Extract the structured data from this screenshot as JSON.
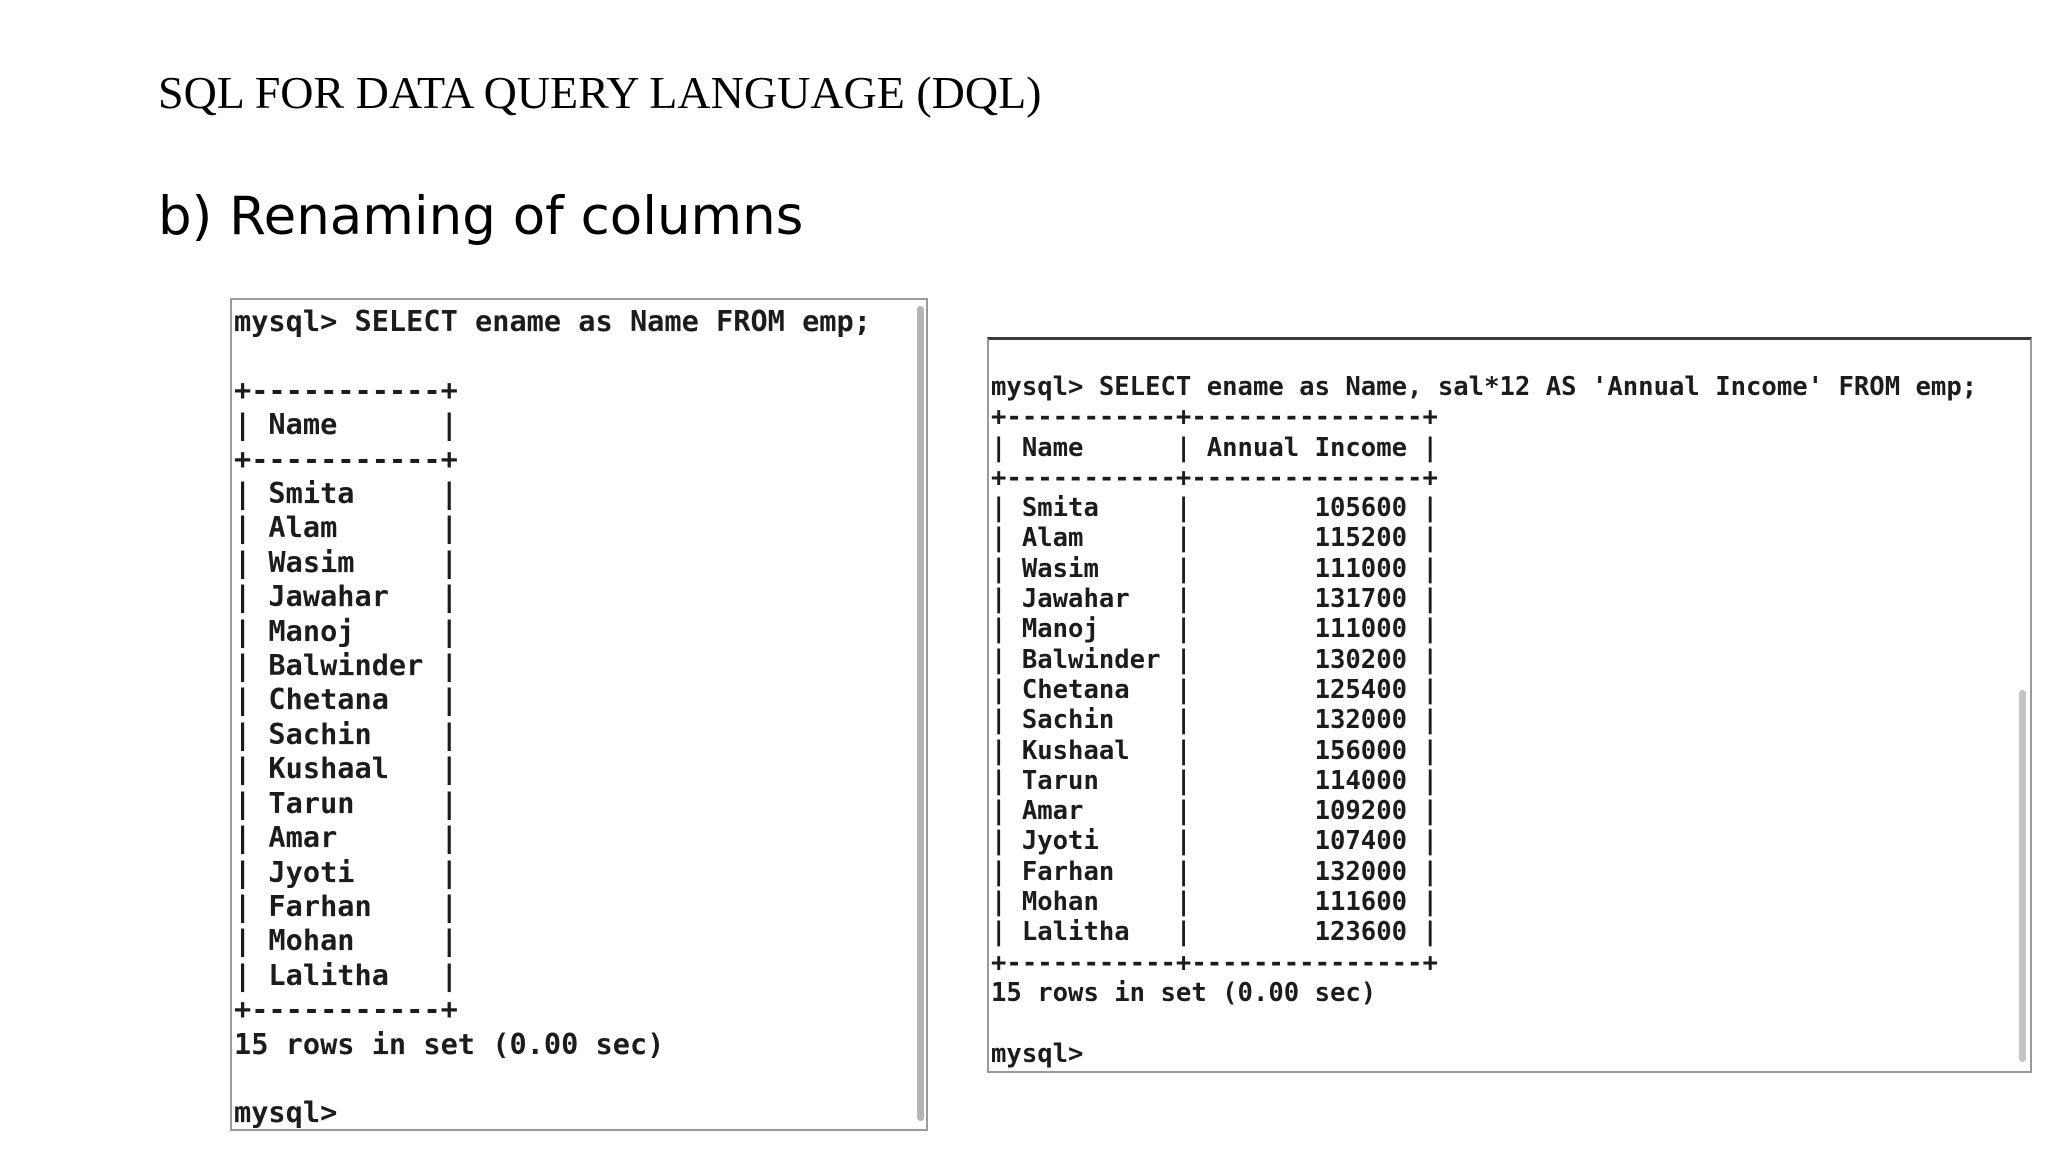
{
  "slide": {
    "heading": "SQL FOR DATA QUERY LANGUAGE (DQL)",
    "subheading": "b) Renaming of columns"
  },
  "terminal_left": {
    "command": "mysql> SELECT ename as Name FROM emp;",
    "header": "Name",
    "rows": [
      "Smita",
      "Alam",
      "Wasim",
      "Jawahar",
      "Manoj",
      "Balwinder",
      "Chetana",
      "Sachin",
      "Kushaal",
      "Tarun",
      "Amar",
      "Jyoti",
      "Farhan",
      "Mohan",
      "Lalitha"
    ],
    "result_summary": "15 rows in set (0.00 sec)",
    "prompt": "mysql>"
  },
  "terminal_right": {
    "command": "mysql> SELECT ename as Name, sal*12 AS 'Annual Income' FROM emp;",
    "headers": [
      "Name",
      "Annual Income"
    ],
    "rows": [
      [
        "Smita",
        "105600"
      ],
      [
        "Alam",
        "115200"
      ],
      [
        "Wasim",
        "111000"
      ],
      [
        "Jawahar",
        "131700"
      ],
      [
        "Manoj",
        "111000"
      ],
      [
        "Balwinder",
        "130200"
      ],
      [
        "Chetana",
        "125400"
      ],
      [
        "Sachin",
        "132000"
      ],
      [
        "Kushaal",
        "156000"
      ],
      [
        "Tarun",
        "114000"
      ],
      [
        "Amar",
        "109200"
      ],
      [
        "Jyoti",
        "107400"
      ],
      [
        "Farhan",
        "132000"
      ],
      [
        "Mohan",
        "111600"
      ],
      [
        "Lalitha",
        "123600"
      ]
    ],
    "result_summary": "15 rows in set (0.00 sec)",
    "prompt": "mysql>"
  }
}
